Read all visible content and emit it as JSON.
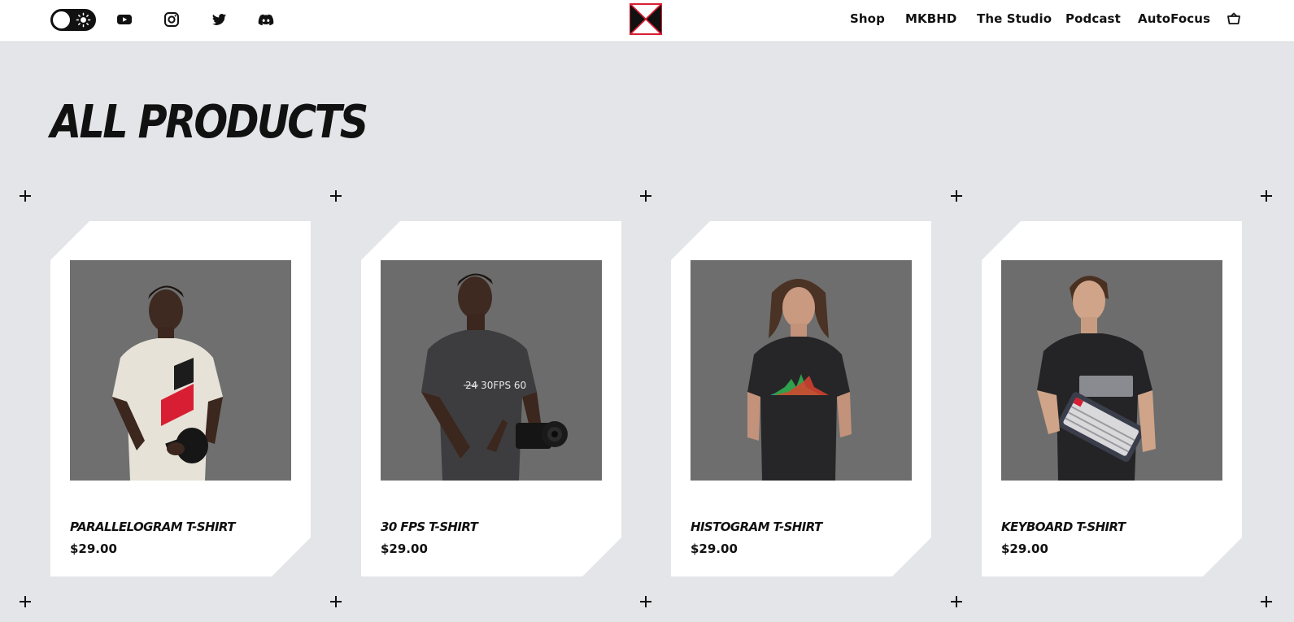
{
  "header": {
    "theme_toggle": {
      "state": "light"
    },
    "social_icons": [
      "youtube-icon",
      "instagram-icon",
      "twitter-icon",
      "discord-icon"
    ],
    "logo": "mkbhd-logo",
    "nav": [
      {
        "label": "Shop"
      },
      {
        "label": "MKBHD"
      },
      {
        "label": "The Studio"
      },
      {
        "label": "Podcast"
      },
      {
        "label": "AutoFocus"
      }
    ],
    "cart_icon": "cart-icon"
  },
  "main": {
    "title": "ALL PRODUCTS"
  },
  "products": [
    {
      "name": "PARALLELOGRAM T-SHIRT",
      "price": "$29.00"
    },
    {
      "name": "30 FPS T-SHIRT",
      "price": "$29.00"
    },
    {
      "name": "HISTOGRAM T-SHIRT",
      "price": "$29.00"
    },
    {
      "name": "KEYBOARD T-SHIRT",
      "price": "$29.00"
    }
  ],
  "colors": {
    "brand_red": "#d81e32",
    "text": "#111111",
    "background": "#e4e5e8",
    "card": "#ffffff",
    "photo_bg": "#6d6d6d"
  }
}
